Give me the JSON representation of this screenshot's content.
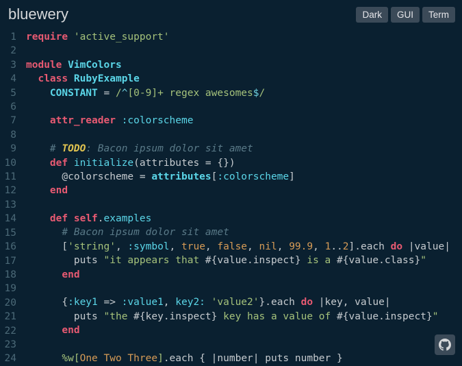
{
  "header": {
    "title": "bluewery",
    "buttons": {
      "dark": "Dark",
      "gui": "GUI",
      "term": "Term"
    }
  },
  "code": {
    "lines": [
      {
        "n": 1,
        "t": [
          [
            "kw-red",
            "require"
          ],
          [
            "punct",
            " "
          ],
          [
            "str",
            "'active_support'"
          ]
        ]
      },
      {
        "n": 2,
        "t": []
      },
      {
        "n": 3,
        "t": [
          [
            "mod",
            "module"
          ],
          [
            "punct",
            " "
          ],
          [
            "cls",
            "VimColors"
          ]
        ]
      },
      {
        "n": 4,
        "t": [
          [
            "punct",
            "  "
          ],
          [
            "mod",
            "class"
          ],
          [
            "punct",
            " "
          ],
          [
            "cls",
            "RubyExample"
          ]
        ]
      },
      {
        "n": 5,
        "t": [
          [
            "punct",
            "    "
          ],
          [
            "cls",
            "CONSTANT"
          ],
          [
            "punct",
            " = "
          ],
          [
            "regex",
            "/"
          ],
          [
            "regex-car",
            "^"
          ],
          [
            "regex",
            "[0-9]+ regex awesomes"
          ],
          [
            "regex-car",
            "$"
          ],
          [
            "regex",
            "/"
          ]
        ]
      },
      {
        "n": 6,
        "t": []
      },
      {
        "n": 7,
        "t": [
          [
            "punct",
            "    "
          ],
          [
            "kw-red",
            "attr_reader"
          ],
          [
            "punct",
            " "
          ],
          [
            "sym",
            ":colorscheme"
          ]
        ]
      },
      {
        "n": 8,
        "t": []
      },
      {
        "n": 9,
        "t": [
          [
            "punct",
            "    "
          ],
          [
            "comment",
            "# "
          ],
          [
            "todo",
            "TODO"
          ],
          [
            "comment",
            ": Bacon ipsum dolor sit amet"
          ]
        ]
      },
      {
        "n": 10,
        "t": [
          [
            "punct",
            "    "
          ],
          [
            "kw-red",
            "def"
          ],
          [
            "punct",
            " "
          ],
          [
            "fn",
            "initialize"
          ],
          [
            "punct",
            "(attributes = {})"
          ]
        ]
      },
      {
        "n": 11,
        "t": [
          [
            "punct",
            "      @colorscheme = "
          ],
          [
            "cls",
            "attributes"
          ],
          [
            "punct",
            "["
          ],
          [
            "sym",
            ":colorscheme"
          ],
          [
            "punct",
            "]"
          ]
        ]
      },
      {
        "n": 12,
        "t": [
          [
            "punct",
            "    "
          ],
          [
            "kw-red",
            "end"
          ]
        ]
      },
      {
        "n": 13,
        "t": []
      },
      {
        "n": 14,
        "t": [
          [
            "punct",
            "    "
          ],
          [
            "kw-red",
            "def"
          ],
          [
            "punct",
            " "
          ],
          [
            "kw-red",
            "self"
          ],
          [
            "punct",
            "."
          ],
          [
            "fn",
            "examples"
          ]
        ]
      },
      {
        "n": 15,
        "t": [
          [
            "punct",
            "      "
          ],
          [
            "comment",
            "# Bacon ipsum dolor sit amet"
          ]
        ]
      },
      {
        "n": 16,
        "t": [
          [
            "punct",
            "      ["
          ],
          [
            "str",
            "'string'"
          ],
          [
            "punct",
            ", "
          ],
          [
            "sym",
            ":symbol"
          ],
          [
            "punct",
            ", "
          ],
          [
            "val",
            "true"
          ],
          [
            "punct",
            ", "
          ],
          [
            "val",
            "false"
          ],
          [
            "punct",
            ", "
          ],
          [
            "val",
            "nil"
          ],
          [
            "punct",
            ", "
          ],
          [
            "val",
            "99.9"
          ],
          [
            "punct",
            ", "
          ],
          [
            "val",
            "1"
          ],
          [
            "punct",
            ".."
          ],
          [
            "val",
            "2"
          ],
          [
            "punct",
            "].each "
          ],
          [
            "kw-red",
            "do"
          ],
          [
            "punct",
            " |value|"
          ]
        ]
      },
      {
        "n": 17,
        "t": [
          [
            "punct",
            "        puts "
          ],
          [
            "str",
            "\"it appears that "
          ],
          [
            "interp",
            "#{"
          ],
          [
            "punct",
            "value.inspect"
          ],
          [
            "interp",
            "}"
          ],
          [
            "str",
            " is a "
          ],
          [
            "interp",
            "#{"
          ],
          [
            "punct",
            "value.class"
          ],
          [
            "interp",
            "}"
          ],
          [
            "str",
            "\""
          ]
        ]
      },
      {
        "n": 18,
        "t": [
          [
            "punct",
            "      "
          ],
          [
            "kw-red",
            "end"
          ]
        ]
      },
      {
        "n": 19,
        "t": []
      },
      {
        "n": 20,
        "t": [
          [
            "punct",
            "      {"
          ],
          [
            "sym",
            ":key1"
          ],
          [
            "punct",
            " => "
          ],
          [
            "sym",
            ":value1"
          ],
          [
            "punct",
            ", "
          ],
          [
            "sym",
            "key2:"
          ],
          [
            "punct",
            " "
          ],
          [
            "str",
            "'value2'"
          ],
          [
            "punct",
            "}.each "
          ],
          [
            "kw-red",
            "do"
          ],
          [
            "punct",
            " |key, value|"
          ]
        ]
      },
      {
        "n": 21,
        "t": [
          [
            "punct",
            "        puts "
          ],
          [
            "str",
            "\"the "
          ],
          [
            "interp",
            "#{"
          ],
          [
            "punct",
            "key.inspect"
          ],
          [
            "interp",
            "}"
          ],
          [
            "str",
            " key has a value of "
          ],
          [
            "interp",
            "#{"
          ],
          [
            "punct",
            "value.inspect"
          ],
          [
            "interp",
            "}"
          ],
          [
            "str",
            "\""
          ]
        ]
      },
      {
        "n": 22,
        "t": [
          [
            "punct",
            "      "
          ],
          [
            "kw-red",
            "end"
          ]
        ]
      },
      {
        "n": 23,
        "t": []
      },
      {
        "n": 24,
        "t": [
          [
            "punct",
            "      "
          ],
          [
            "regex",
            "%w["
          ],
          [
            "val",
            "One Two Three"
          ],
          [
            "regex",
            "]"
          ],
          [
            "punct",
            ".each { |number| puts number }"
          ]
        ]
      }
    ]
  },
  "colors": {
    "background": "#0a2030",
    "keyword_red": "#e85a72",
    "string": "#a5c27b",
    "class_cyan": "#5bd6e8",
    "number_orange": "#d69b56",
    "comment": "#5a7a88",
    "todo": "#e0c350",
    "gutter": "#4c6a78",
    "text": "#c6cbcf"
  }
}
